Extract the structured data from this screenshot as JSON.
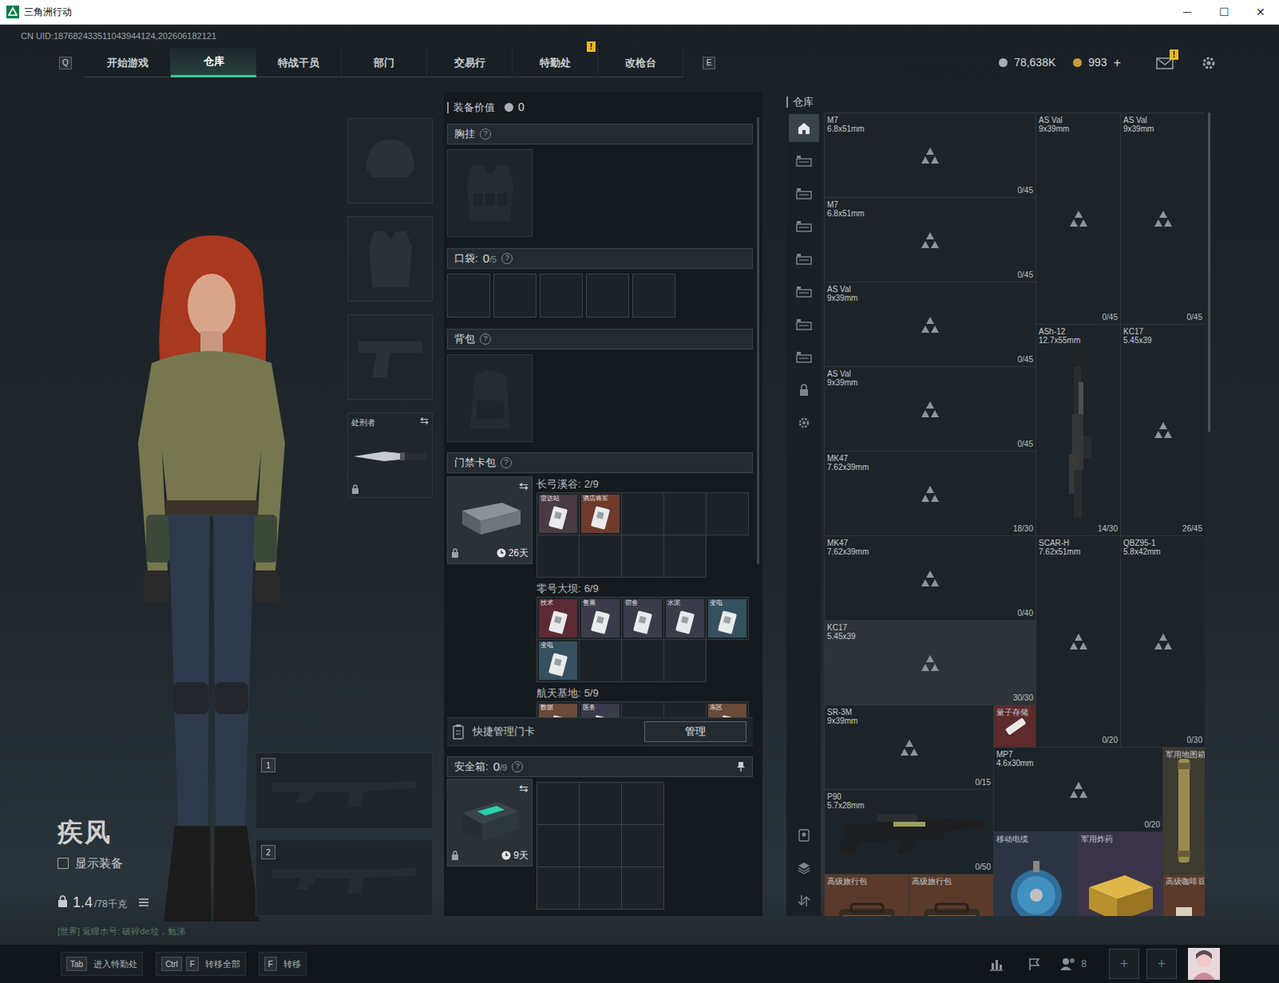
{
  "window": {
    "title": "三角洲行动",
    "controls": [
      "─",
      "☐",
      "✕"
    ]
  },
  "uid": "CN UID:187682433511043944124,202606182121",
  "nav": {
    "left_key": "Q",
    "right_key": "E",
    "alert_glyph": "!",
    "tabs": [
      {
        "label": "开始游戏",
        "selected": false,
        "alert": false
      },
      {
        "label": "仓库",
        "selected": true,
        "alert": false
      },
      {
        "label": "特战干员",
        "selected": false,
        "alert": false
      },
      {
        "label": "部门",
        "selected": false,
        "alert": false
      },
      {
        "label": "交易行",
        "selected": false,
        "alert": false
      },
      {
        "label": "特勤处",
        "selected": false,
        "alert": true
      },
      {
        "label": "改枪台",
        "selected": false,
        "alert": false
      }
    ]
  },
  "currency": {
    "silver": "78,638K",
    "coins": "993",
    "add": "+"
  },
  "mail": {
    "alert": true,
    "alert_glyph": "!"
  },
  "character": {
    "name": "疾风",
    "show_equipment": {
      "label": "显示装备",
      "checked": false
    },
    "weight": "1.4",
    "weight_max": "/78千克"
  },
  "chat": "[世界] 返瞳ホ号: 破碎de垃，勉涕",
  "equipment": [
    {
      "kind": "helmet"
    },
    {
      "kind": "armor"
    },
    {
      "kind": "pistol"
    },
    {
      "kind": "melee",
      "label": "处刑者",
      "swap": "⇆",
      "locked": true
    }
  ],
  "weapon_slots": [
    {
      "number": "1"
    },
    {
      "number": "2"
    }
  ],
  "loadout": {
    "value_label": "装备价值",
    "value": "0",
    "chest_rig": {
      "label": "胸挂",
      "help": "?"
    },
    "pockets": {
      "label": "口袋:",
      "count": "0",
      "max": "/5",
      "help": "?",
      "slots": 5
    },
    "backpack": {
      "label": "背包",
      "help": "?"
    },
    "keycards": {
      "label": "门禁卡包",
      "help": "?",
      "swap": "⇆",
      "locked": true,
      "timer": "26天",
      "maps": [
        {
          "name": "长弓溪谷:",
          "count": "2/9",
          "slots": [
            {
              "filled": true,
              "label": "雷达站",
              "color": "#4a3a42"
            },
            {
              "filled": true,
              "label": "酒店将军",
              "color": "#6e3a2c"
            },
            {
              "filled": false
            },
            {
              "filled": false
            },
            {
              "filled": false
            },
            {
              "filled": false
            },
            {
              "filled": false
            },
            {
              "filled": false
            },
            {
              "filled": false
            }
          ]
        },
        {
          "name": "零号大坝:",
          "count": "6/9",
          "slots": [
            {
              "filled": true,
              "label": "技术",
              "color": "#5c2a32"
            },
            {
              "filled": true,
              "label": "售票",
              "color": "#3a3c4a"
            },
            {
              "filled": true,
              "label": "宿舍",
              "color": "#3a3c4a"
            },
            {
              "filled": true,
              "label": "水泥",
              "color": "#3a3c4a"
            },
            {
              "filled": true,
              "label": "变电",
              "color": "#35505e"
            },
            {
              "filled": true,
              "label": "变电",
              "color": "#35505e"
            },
            {
              "filled": false
            },
            {
              "filled": false
            },
            {
              "filled": false
            }
          ]
        },
        {
          "name": "航天基地:",
          "count": "5/9",
          "slots": [
            {
              "filled": true,
              "label": "数据",
              "color": "#6a4a3a"
            },
            {
              "filled": true,
              "label": "医务",
              "color": "#3a3c4a"
            },
            {
              "filled": false
            },
            {
              "filled": false
            },
            {
              "filled": true,
              "label": "东区",
              "color": "#6a4a3a"
            }
          ]
        }
      ]
    },
    "quick_manage": {
      "label": "快捷管理门卡",
      "button": "管理"
    },
    "safe_box": {
      "label": "安全箱:",
      "count": "0",
      "max": "/9",
      "help": "?",
      "swap": "⇆",
      "locked": true,
      "timer": "9天",
      "slots": 9
    }
  },
  "warehouse": {
    "label": "仓库",
    "side_tabs": [
      {
        "kind": "home",
        "selected": true
      },
      {
        "kind": "case",
        "selected": false
      },
      {
        "kind": "case",
        "selected": false
      },
      {
        "kind": "case",
        "selected": false
      },
      {
        "kind": "case",
        "selected": false
      },
      {
        "kind": "case",
        "selected": false
      },
      {
        "kind": "case",
        "selected": false
      },
      {
        "kind": "case",
        "selected": false
      },
      {
        "kind": "lock",
        "selected": false
      },
      {
        "kind": "gear",
        "selected": false
      }
    ],
    "side_tabs_bottom": [
      {
        "kind": "badge",
        "selected": false
      },
      {
        "kind": "layers",
        "selected": false
      },
      {
        "kind": "transfer",
        "selected": false
      }
    ],
    "items": [
      {
        "name": "M7",
        "caliber": "6.8x51mm",
        "count": "0/45",
        "kind": "placeholder",
        "color": "#1d2429",
        "highlighted": false
      },
      {
        "name": "AS Val",
        "caliber": "9x39mm",
        "count": "0/45",
        "kind": "placeholder",
        "color": "#1d2429",
        "highlighted": false
      },
      {
        "name": "AS Val",
        "caliber": "9x39mm",
        "count": "0/45",
        "kind": "placeholder",
        "color": "#1d2429",
        "highlighted": false
      },
      {
        "name": "M7",
        "caliber": "6.8x51mm",
        "count": "0/45",
        "kind": "placeholder",
        "color": "#1d2429",
        "highlighted": false
      },
      {
        "name": "AS Val",
        "caliber": "9x39mm",
        "count": "0/45",
        "kind": "placeholder",
        "color": "#1d2429",
        "highlighted": false
      },
      {
        "name": "AS Val",
        "caliber": "9x39mm",
        "count": "0/45",
        "kind": "placeholder",
        "color": "#1d2429",
        "highlighted": false
      },
      {
        "name": "ASh-12",
        "caliber": "12.7x55mm",
        "count": "14/30",
        "kind": "picture",
        "color": "#1d2429",
        "highlighted": false
      },
      {
        "name": "KC17",
        "caliber": "5.45x39",
        "count": "26/45",
        "kind": "placeholder",
        "color": "#1d2429",
        "highlighted": false
      },
      {
        "name": "MK47",
        "caliber": "7.62x39mm",
        "count": "18/30",
        "kind": "placeholder",
        "color": "#1d2429",
        "highlighted": false
      },
      {
        "name": "MK47",
        "caliber": "7.62x39mm",
        "count": "0/40",
        "kind": "placeholder",
        "color": "#1d2429",
        "highlighted": false
      },
      {
        "name": "SCAR-H",
        "caliber": "7.62x51mm",
        "count": "0/20",
        "kind": "placeholder",
        "color": "#1d2429",
        "highlighted": false
      },
      {
        "name": "QBZ95-1",
        "caliber": "5.8x42mm",
        "count": "0/30",
        "kind": "placeholder",
        "color": "#1d2429",
        "highlighted": false
      },
      {
        "name": "KC17",
        "caliber": "5.45x39",
        "count": "30/30",
        "kind": "placeholder",
        "color": "#1d2429",
        "highlighted": true
      },
      {
        "name": "SR-3M",
        "caliber": "9x39mm",
        "count": "0/15",
        "kind": "placeholder",
        "color": "#1d2429",
        "highlighted": false
      },
      {
        "name": "量子存储",
        "kind": "picture",
        "color": "#5e2a2c",
        "highlighted": false
      },
      {
        "name": "MP7",
        "caliber": "4.6x30mm",
        "count": "0/20",
        "kind": "placeholder",
        "color": "#1d2429",
        "highlighted": false
      },
      {
        "name": "军用地图箱",
        "kind": "picture",
        "color": "#3d3a30",
        "highlighted": false
      },
      {
        "name": "P90",
        "caliber": "5.7x28mm",
        "count": "0/50",
        "kind": "picture",
        "color": "#1d2429",
        "highlighted": false
      },
      {
        "name": "移动电缆",
        "kind": "picture",
        "color": "#2c3444",
        "highlighted": false
      },
      {
        "name": "军用炸药",
        "kind": "picture",
        "color": "#3a3448",
        "highlighted": false
      },
      {
        "name": "高级旅行包",
        "kind": "picture",
        "color": "#5a3a2a",
        "highlighted": false
      },
      {
        "name": "高级旅行包",
        "kind": "picture",
        "color": "#5a3a2a",
        "highlighted": false
      },
      {
        "name": "高级咖啡豆",
        "kind": "picture",
        "color": "#5a3a2a",
        "highlighted": false
      }
    ]
  },
  "hotkeys": [
    {
      "keys": [
        "Tab"
      ],
      "label": "进入特勤处"
    },
    {
      "keys": [
        "Ctrl",
        "F"
      ],
      "label": "转移全部"
    },
    {
      "keys": [
        "F"
      ],
      "label": "转移"
    }
  ],
  "social": {
    "friends_count": "8",
    "slots": [
      "+",
      "+"
    ]
  }
}
